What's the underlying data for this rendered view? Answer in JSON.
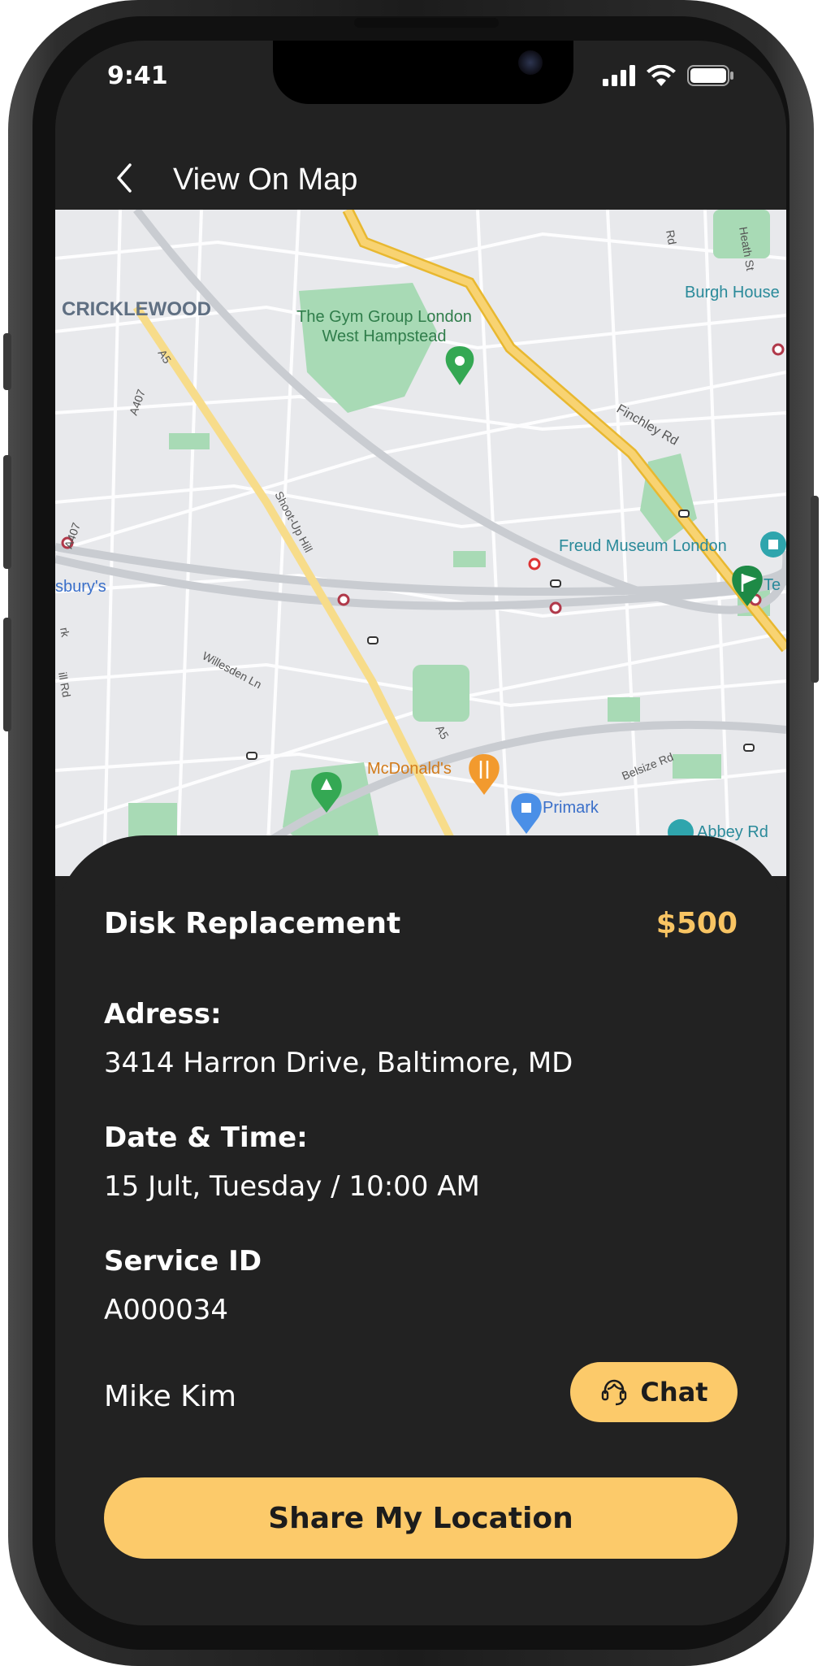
{
  "status_bar": {
    "time": "9:41"
  },
  "header": {
    "title": "View On Map",
    "back_icon": "chevron-left-icon"
  },
  "map": {
    "labels": {
      "cricklewood": "CRICKLEWOOD",
      "gym_line1": "The Gym Group London",
      "gym_line2": "West Hampstead",
      "burgh_house": "Burgh House",
      "freud": "Freud Museum London",
      "sainsburys": "sbury's",
      "mcdonalds": "McDonald's",
      "primark": "Primark",
      "abbey": "Abbey Rd",
      "finchley": "Finchley Rd",
      "shootup": "Shoot-Up Hill",
      "willesden": "Willesden Ln",
      "belsize": "Belsize Rd",
      "heath": "Heath St",
      "a5_top": "A5",
      "a5_mid": "A5",
      "a407_top": "A407",
      "a407_mid": "A407",
      "te": "Te",
      "rd": "Rd",
      "rk": "rk",
      "ill": "ill Rd"
    }
  },
  "job": {
    "service_name": "Disk Replacement",
    "price": "$500",
    "address_label": "Adress:",
    "address_value": "3414 Harron Drive, Baltimore, MD",
    "datetime_label": "Date & Time:",
    "datetime_value": "15 Jult, Tuesday / 10:00 AM",
    "service_id_label": "Service ID",
    "service_id_value": "A000034",
    "person_name": "Mike Kim",
    "chat_label": "Chat",
    "share_label": "Share My Location"
  },
  "colors": {
    "accent": "#fcca6a",
    "price": "#f8c463",
    "background": "#222222",
    "text": "#ffffff"
  }
}
